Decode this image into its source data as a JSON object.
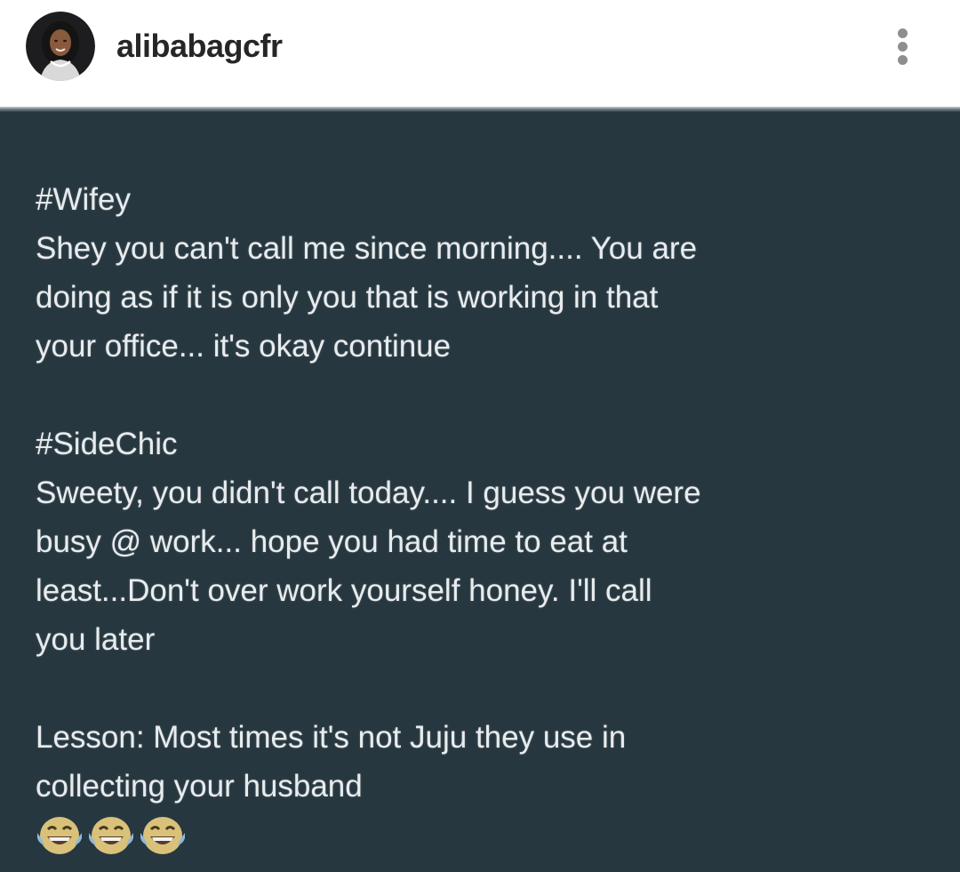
{
  "header": {
    "username": "alibabagcfr"
  },
  "post": {
    "wifey_tag": "#Wifey",
    "wifey_lines": [
      "Shey you can't call me since morning.... You are",
      "doing as if it is only you that is working in that",
      "your office... it's okay continue"
    ],
    "sidechic_tag": "#SideChic",
    "sidechic_lines": [
      "Sweety, you didn't call today.... I guess you were",
      "busy @ work...  hope you had time to eat at",
      "least...Don't over work yourself honey. I'll call",
      "you later"
    ],
    "lesson_lines": [
      "Lesson: Most times it's not Juju they use in",
      "collecting your husband"
    ],
    "emojis": [
      "laughing-tears-icon",
      "laughing-tears-icon",
      "laughing-tears-icon"
    ]
  }
}
